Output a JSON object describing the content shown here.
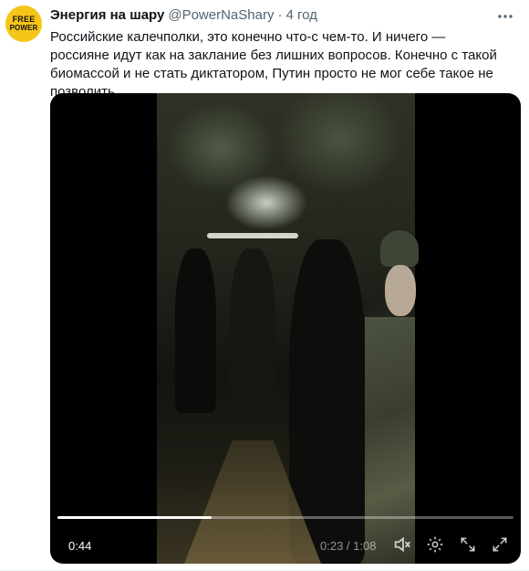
{
  "author": {
    "name": "Энергия на шару",
    "handle": "@PowerNaShary",
    "separator": "·",
    "time": "4 год",
    "avatar_text_line1": "FREE",
    "avatar_text_line2": "POWER"
  },
  "tweet_text": "Российские калечполки, это конечно что-с чем-то. И ничего — россияне идут как на заклание без лишних вопросов. Конечно с такой биомассой и не стать диктатором, Путин просто не мог себе такое не позволить.",
  "video": {
    "remaining_time": "0:44",
    "current_time": "0:23 / 1:08",
    "progress_fraction": 0.338,
    "icons": [
      "volume-icon",
      "settings-icon",
      "popout-icon",
      "fullscreen-icon"
    ]
  },
  "colors": {
    "accent": "#1d9bf0",
    "secondary_text": "#536471",
    "avatar_bg": "#f5c518"
  }
}
